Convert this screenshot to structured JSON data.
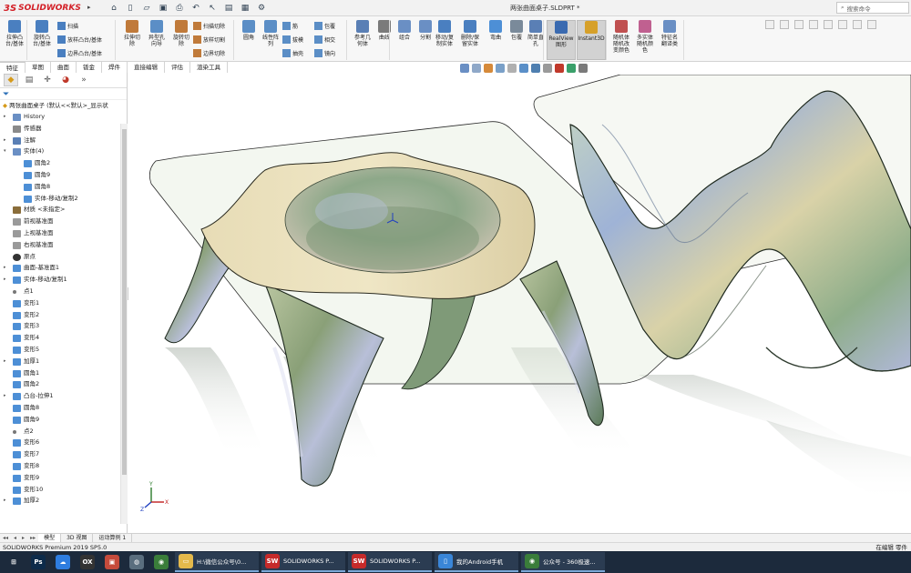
{
  "app": {
    "logo_text": "SOLIDWORKS",
    "logo_mark": "3S",
    "document_title": "两张曲面桌子.SLDPRT *",
    "search_placeholder": "搜索命令"
  },
  "ribbon": {
    "groups": [
      {
        "label": "拉伸凸\n台/基体",
        "icon": "extrude-boss-icon"
      },
      {
        "label": "旋转凸\n台/基体",
        "icon": "revolve-boss-icon"
      },
      {
        "label": "异型孔\n向导",
        "icon": "hole-wizard-icon"
      },
      {
        "label": "拉伸切\n除",
        "icon": "extrude-cut-icon"
      },
      {
        "label": "旋转切\n除",
        "icon": "revolve-cut-icon"
      },
      {
        "label": "圆角",
        "icon": "fillet-icon"
      },
      {
        "label": "线性阵\n列",
        "icon": "linear-pattern-icon"
      },
      {
        "label": "参考几\n何体",
        "icon": "reference-geometry-icon"
      },
      {
        "label": "曲线",
        "icon": "curves-icon"
      },
      {
        "label": "组合",
        "icon": "combine-icon"
      },
      {
        "label": "分割",
        "icon": "split-icon"
      },
      {
        "label": "移动/复\n制实体",
        "icon": "move-copy-icon"
      },
      {
        "label": "删除/保\n留实体",
        "icon": "delete-body-icon"
      },
      {
        "label": "弯曲",
        "icon": "flex-icon"
      },
      {
        "label": "包覆",
        "icon": "wrap-icon"
      },
      {
        "label": "简单直\n孔",
        "icon": "simple-hole-icon"
      },
      {
        "label": "RealView\n图形",
        "icon": "realview-icon"
      },
      {
        "label": "Instant3D",
        "icon": "instant3d-icon"
      },
      {
        "label": "随机体\n随机改\n变颜色",
        "icon": "random-color-icon"
      },
      {
        "label": "多实体\n随机颜\n色",
        "icon": "multibody-color-icon"
      },
      {
        "label": "特征名\n翻译类",
        "icon": "feature-translate-icon"
      }
    ],
    "small_items": [
      {
        "label": "扫描",
        "icon": "sweep-icon"
      },
      {
        "label": "放样凸台/基体",
        "icon": "loft-icon"
      },
      {
        "label": "边界凸台/基体",
        "icon": "boundary-icon"
      },
      {
        "label": "扫描切除",
        "icon": "sweep-cut-icon"
      },
      {
        "label": "放样切割",
        "icon": "loft-cut-icon"
      },
      {
        "label": "边界切除",
        "icon": "boundary-cut-icon"
      },
      {
        "label": "筋",
        "icon": "rib-icon"
      },
      {
        "label": "拔模",
        "icon": "draft-icon"
      },
      {
        "label": "抽壳",
        "icon": "shell-icon"
      },
      {
        "label": "包覆",
        "icon": "wrap-small-icon"
      },
      {
        "label": "相交",
        "icon": "intersect-icon"
      },
      {
        "label": "镜向",
        "icon": "mirror-icon"
      }
    ]
  },
  "tabs": [
    "特征",
    "草图",
    "曲面",
    "钣金",
    "焊件",
    "直接编辑",
    "评估",
    "渲染工具"
  ],
  "feature_manager": {
    "root_label": "两张曲面桌子 (默认<<默认>_显示状",
    "items": [
      {
        "label": "History",
        "indent": 1,
        "expand": "▸",
        "icon": "history-icon",
        "color": "#6a8fc4"
      },
      {
        "label": "传感器",
        "indent": 1,
        "expand": "",
        "icon": "sensor-icon",
        "color": "#8a8a8a"
      },
      {
        "label": "注解",
        "indent": 1,
        "expand": "▸",
        "icon": "annotation-icon",
        "color": "#5a7fb5"
      },
      {
        "label": "实体(4)",
        "indent": 1,
        "expand": "▾",
        "icon": "solid-bodies-icon",
        "color": "#6a8fc4"
      },
      {
        "label": "圆角2",
        "indent": 2,
        "expand": "",
        "icon": "body-icon",
        "color": "#4d8fd6"
      },
      {
        "label": "圆角9",
        "indent": 2,
        "expand": "",
        "icon": "body-icon",
        "color": "#4d8fd6"
      },
      {
        "label": "圆角8",
        "indent": 2,
        "expand": "",
        "icon": "body-icon",
        "color": "#4d8fd6"
      },
      {
        "label": "实体-移动/复制2",
        "indent": 2,
        "expand": "",
        "icon": "body-icon",
        "color": "#4d8fd6"
      },
      {
        "label": "材质 <未指定>",
        "indent": 1,
        "expand": "",
        "icon": "material-icon",
        "color": "#8a6d3a"
      },
      {
        "label": "前视基准面",
        "indent": 1,
        "expand": "",
        "icon": "plane-icon",
        "color": "#9a9a9a"
      },
      {
        "label": "上视基准面",
        "indent": 1,
        "expand": "",
        "icon": "plane-icon",
        "color": "#9a9a9a"
      },
      {
        "label": "右视基准面",
        "indent": 1,
        "expand": "",
        "icon": "plane-icon",
        "color": "#9a9a9a"
      },
      {
        "label": "原点",
        "indent": 1,
        "expand": "",
        "icon": "origin-icon",
        "color": "#333"
      },
      {
        "label": "曲面-基准面1",
        "indent": 1,
        "expand": "▸",
        "icon": "surface-icon",
        "color": "#4d8fd6"
      },
      {
        "label": "实体-移动/复制1",
        "indent": 1,
        "expand": "▸",
        "icon": "move-body-icon",
        "color": "#4d8fd6"
      },
      {
        "label": "点1",
        "indent": 1,
        "expand": "",
        "icon": "point-icon",
        "color": "#777"
      },
      {
        "label": "变形1",
        "indent": 1,
        "expand": "",
        "icon": "deform-icon",
        "color": "#4d8fd6"
      },
      {
        "label": "变形2",
        "indent": 1,
        "expand": "",
        "icon": "deform-icon",
        "color": "#4d8fd6"
      },
      {
        "label": "变形3",
        "indent": 1,
        "expand": "",
        "icon": "deform-icon",
        "color": "#4d8fd6"
      },
      {
        "label": "变形4",
        "indent": 1,
        "expand": "",
        "icon": "deform-icon",
        "color": "#4d8fd6"
      },
      {
        "label": "变形5",
        "indent": 1,
        "expand": "",
        "icon": "deform-icon",
        "color": "#4d8fd6"
      },
      {
        "label": "加厚1",
        "indent": 1,
        "expand": "▸",
        "icon": "thicken-icon",
        "color": "#4d8fd6"
      },
      {
        "label": "圆角1",
        "indent": 1,
        "expand": "",
        "icon": "fillet-feature-icon",
        "color": "#4d8fd6"
      },
      {
        "label": "圆角2",
        "indent": 1,
        "expand": "",
        "icon": "fillet-feature-icon",
        "color": "#4d8fd6"
      },
      {
        "label": "凸台-拉伸1",
        "indent": 1,
        "expand": "▸",
        "icon": "boss-extrude-icon",
        "color": "#4d8fd6"
      },
      {
        "label": "圆角8",
        "indent": 1,
        "expand": "",
        "icon": "fillet-feature-icon",
        "color": "#4d8fd6"
      },
      {
        "label": "圆角9",
        "indent": 1,
        "expand": "",
        "icon": "fillet-feature-icon",
        "color": "#4d8fd6"
      },
      {
        "label": "点2",
        "indent": 1,
        "expand": "",
        "icon": "point-icon",
        "color": "#777"
      },
      {
        "label": "变形6",
        "indent": 1,
        "expand": "",
        "icon": "deform-icon",
        "color": "#4d8fd6"
      },
      {
        "label": "变形7",
        "indent": 1,
        "expand": "",
        "icon": "deform-icon",
        "color": "#4d8fd6"
      },
      {
        "label": "变形8",
        "indent": 1,
        "expand": "",
        "icon": "deform-icon",
        "color": "#4d8fd6"
      },
      {
        "label": "变形9",
        "indent": 1,
        "expand": "",
        "icon": "deform-icon",
        "color": "#4d8fd6"
      },
      {
        "label": "变形10",
        "indent": 1,
        "expand": "",
        "icon": "deform-icon",
        "color": "#4d8fd6"
      },
      {
        "label": "加厚2",
        "indent": 1,
        "expand": "▸",
        "icon": "thicken-icon",
        "color": "#4d8fd6"
      }
    ]
  },
  "bottom_tabs": [
    "模型",
    "3D 视图",
    "运动算例 1"
  ],
  "status": {
    "left": "SOLIDWORKS Premium 2019 SP5.0",
    "right": "在编辑 零件"
  },
  "taskbar": {
    "apps": [
      {
        "label": "",
        "icon": "windows-start-icon",
        "color": "#1c2a3c",
        "glyph": "⊞"
      },
      {
        "label": "",
        "icon": "photoshop-icon",
        "color": "#0d2b4a",
        "glyph": "Ps"
      },
      {
        "label": "",
        "icon": "baidu-netdisk-icon",
        "color": "#2e7de0",
        "glyph": "☁"
      },
      {
        "label": "",
        "icon": "video-app-icon",
        "color": "#333",
        "glyph": "OX"
      },
      {
        "label": "",
        "icon": "image-app-icon",
        "color": "#c64b3c",
        "glyph": "▣"
      },
      {
        "label": "",
        "icon": "wechat-icon",
        "color": "#5a6e7e",
        "glyph": "◍"
      },
      {
        "label": "",
        "icon": "chrome-icon",
        "color": "#3a7d3a",
        "glyph": "◉"
      }
    ],
    "windows": [
      {
        "label": "H:\\微信公众号\\0...",
        "icon": "folder-icon",
        "color": "#e5b94b",
        "glyph": "▭"
      },
      {
        "label": "SOLIDWORKS P...",
        "icon": "solidworks-icon",
        "color": "#c62a2a",
        "glyph": "SW"
      },
      {
        "label": "SOLIDWORKS P...",
        "icon": "solidworks-icon",
        "color": "#c62a2a",
        "glyph": "SW"
      },
      {
        "label": "我的Android手机",
        "icon": "phone-icon",
        "color": "#3a86d8",
        "glyph": "▯"
      },
      {
        "label": "公众号 - 360极速...",
        "icon": "browser-icon",
        "color": "#3a7d3a",
        "glyph": "◉"
      }
    ]
  }
}
